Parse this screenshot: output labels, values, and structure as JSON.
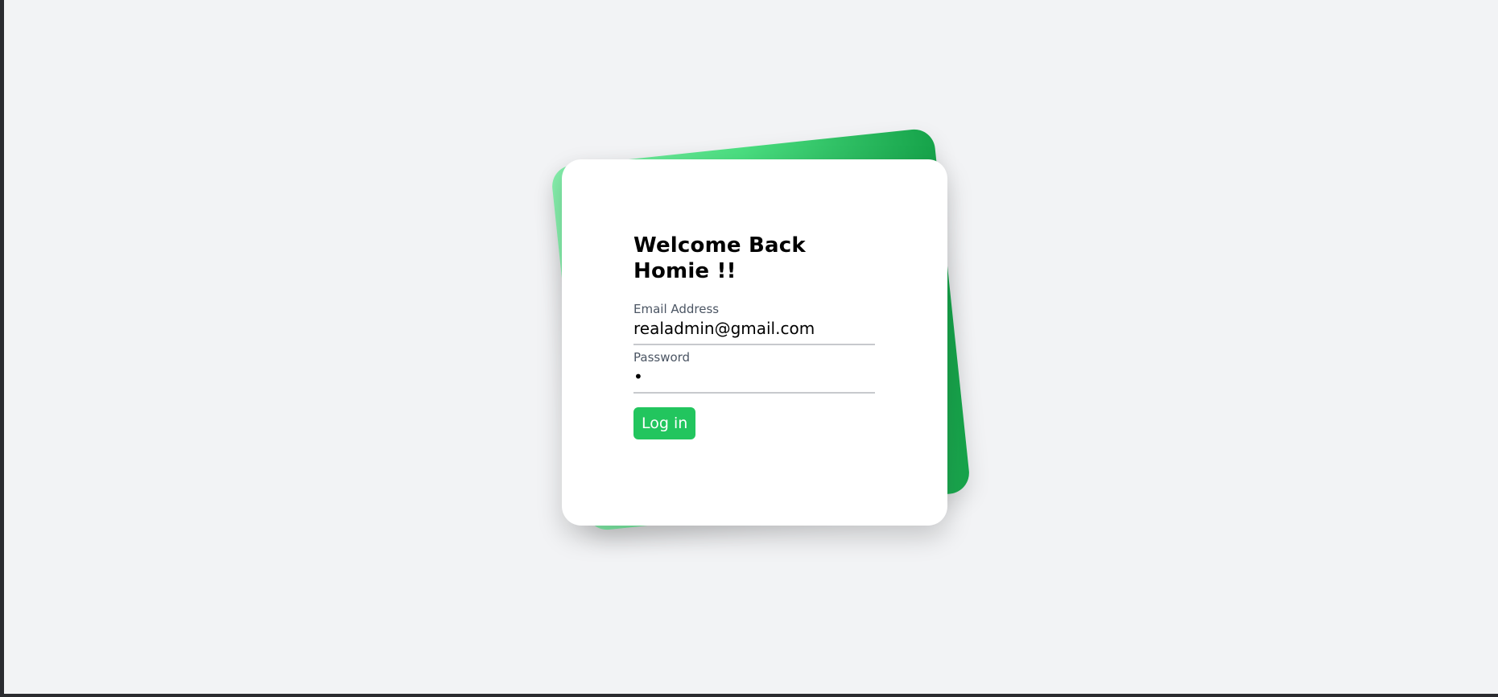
{
  "login": {
    "title": "Welcome Back Homie !!",
    "email": {
      "label": "Email Address",
      "value": "realadmin@gmail.com"
    },
    "password": {
      "label": "Password",
      "value": "•"
    },
    "submit_label": "Log in"
  },
  "colors": {
    "background": "#f2f3f5",
    "accent": "#22c55e",
    "card_back_gradient_start": "#86efac",
    "card_back_gradient_end": "#16a34a"
  }
}
